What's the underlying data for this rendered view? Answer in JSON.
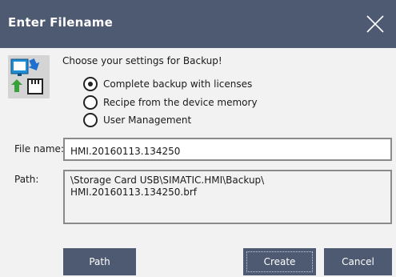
{
  "window": {
    "title": "Enter Filename"
  },
  "settings": {
    "prompt": "Choose your settings for Backup!",
    "options": [
      {
        "label": "Complete backup with licenses",
        "selected": true
      },
      {
        "label": "Recipe from the device memory",
        "selected": false
      },
      {
        "label": "User Management",
        "selected": false
      }
    ]
  },
  "filename": {
    "label": "File name:",
    "value": "HMI.20160113.134250"
  },
  "path": {
    "label": "Path:",
    "line1": "\\Storage Card USB\\SIMATIC.HMI\\Backup\\",
    "line2": "HMI.20160113.134250.brf"
  },
  "buttons": {
    "path": "Path",
    "create": "Create",
    "cancel": "Cancel"
  },
  "colors": {
    "titlebar": "#4e5a72",
    "button": "#4e5a72",
    "dialog_background": "#f2f2f2"
  },
  "icons": {
    "close": "close-icon",
    "backup": "backup-icon"
  }
}
